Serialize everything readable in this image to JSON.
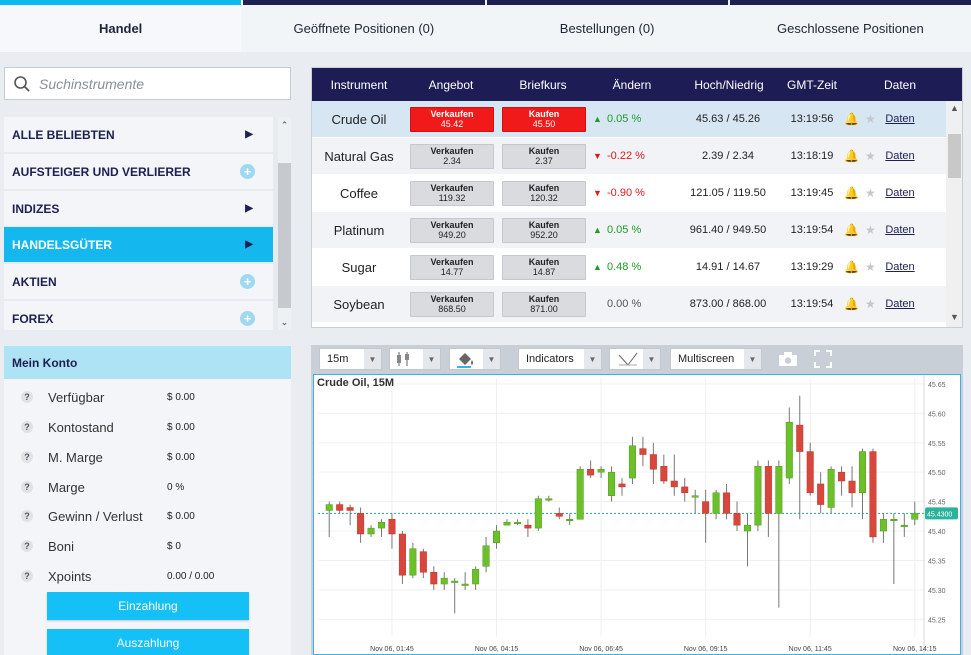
{
  "tabs": [
    {
      "label": "Handel",
      "active": true
    },
    {
      "label": "Geöffnete Positionen (0)",
      "active": false
    },
    {
      "label": "Bestellungen (0)",
      "active": false
    },
    {
      "label": "Geschlossene Positionen",
      "active": false
    }
  ],
  "search": {
    "placeholder": "Suchinstrumente"
  },
  "categories": [
    {
      "label": "ALLE BELIEBTEN",
      "marker": "arrow",
      "active": false
    },
    {
      "label": "AUFSTEIGER UND VERLIERER",
      "marker": "plus",
      "active": false
    },
    {
      "label": "INDIZES",
      "marker": "arrow",
      "active": false
    },
    {
      "label": "HANDELSGÜTER",
      "marker": "arrow",
      "active": true
    },
    {
      "label": "AKTIEN",
      "marker": "plus",
      "active": false
    },
    {
      "label": "FOREX",
      "marker": "plus",
      "active": false
    }
  ],
  "account": {
    "title": "Mein Konto",
    "rows": [
      {
        "label": "Verfügbar",
        "value": "$ 0.00"
      },
      {
        "label": "Kontostand",
        "value": "$ 0.00"
      },
      {
        "label": "M. Marge",
        "value": "$ 0.00"
      },
      {
        "label": "Marge",
        "value": "0 %"
      },
      {
        "label": "Gewinn / Verlust",
        "value": "$ 0.00"
      },
      {
        "label": "Boni",
        "value": "$ 0"
      },
      {
        "label": "Xpoints",
        "value": "0.00 / 0.00"
      }
    ],
    "deposit_label": "Einzahlung",
    "withdraw_label": "Auszahlung"
  },
  "table": {
    "headers": [
      "Instrument",
      "Angebot",
      "Briefkurs",
      "Ändern",
      "Hoch/Niedrig",
      "GMT-Zeit",
      "Daten"
    ],
    "sell_label": "Verkaufen",
    "buy_label": "Kaufen",
    "rows": [
      {
        "instrument": "Crude Oil",
        "bid": "45.42",
        "ask": "45.50",
        "change": "0.05 %",
        "dir": "up",
        "highlow": "45.63 / 45.26",
        "time": "13:19:56",
        "daten": "Daten",
        "selected": true
      },
      {
        "instrument": "Natural Gas",
        "bid": "2.34",
        "ask": "2.37",
        "change": "-0.22 %",
        "dir": "down",
        "highlow": "2.39 / 2.34",
        "time": "13:18:19",
        "daten": "Daten",
        "selected": false
      },
      {
        "instrument": "Coffee",
        "bid": "119.32",
        "ask": "120.32",
        "change": "-0.90 %",
        "dir": "down",
        "highlow": "121.05 / 119.50",
        "time": "13:19:45",
        "daten": "Daten",
        "selected": false
      },
      {
        "instrument": "Platinum",
        "bid": "949.20",
        "ask": "952.20",
        "change": "0.05 %",
        "dir": "up",
        "highlow": "961.40 / 949.50",
        "time": "13:19:54",
        "daten": "Daten",
        "selected": false
      },
      {
        "instrument": "Sugar",
        "bid": "14.77",
        "ask": "14.87",
        "change": "0.48 %",
        "dir": "up",
        "highlow": "14.91 / 14.67",
        "time": "13:19:29",
        "daten": "Daten",
        "selected": false
      },
      {
        "instrument": "Soybean",
        "bid": "868.50",
        "ask": "871.00",
        "change": "0.00 %",
        "dir": "flat",
        "highlow": "873.00 / 868.00",
        "time": "13:19:54",
        "daten": "Daten",
        "selected": false
      }
    ]
  },
  "chart_toolbar": {
    "interval": "15m",
    "indicators": "Indicators",
    "layout": "Multiscreen"
  },
  "colors": {
    "accent": "#14b8ee",
    "navy": "#1d1c55",
    "bull": "#6cc02a",
    "bear": "#d9473c"
  },
  "chart_data": {
    "type": "candlestick",
    "title": "Crude Oil, 15M",
    "ylim": [
      45.22,
      45.66
    ],
    "yticks": [
      "45.65",
      "45.60",
      "45.55",
      "45.50",
      "45.45",
      "45.40",
      "45.35",
      "45.30",
      "45.25"
    ],
    "xticks": [
      {
        "label": "Nov 06, 01:45",
        "index": 6
      },
      {
        "label": "Nov 06, 04:15",
        "index": 16
      },
      {
        "label": "Nov 06, 06:45",
        "index": 26
      },
      {
        "label": "Nov 06, 09:15",
        "index": 36
      },
      {
        "label": "Nov 06, 11:45",
        "index": 46
      },
      {
        "label": "Nov 06, 14:15",
        "index": 56
      }
    ],
    "last_price": "45.4300",
    "last_value": 45.43,
    "candles": [
      [
        45.435,
        45.445,
        45.45,
        45.39
      ],
      [
        45.445,
        45.435,
        45.45,
        45.43
      ],
      [
        45.44,
        45.435,
        45.445,
        45.41
      ],
      [
        45.43,
        45.395,
        45.44,
        45.38
      ],
      [
        45.395,
        45.405,
        45.41,
        45.39
      ],
      [
        45.405,
        45.415,
        45.42,
        45.39
      ],
      [
        45.42,
        45.395,
        45.43,
        45.37
      ],
      [
        45.395,
        45.325,
        45.4,
        45.31
      ],
      [
        45.325,
        45.37,
        45.38,
        45.32
      ],
      [
        45.365,
        45.33,
        45.37,
        45.32
      ],
      [
        45.33,
        45.31,
        45.34,
        45.3
      ],
      [
        45.31,
        45.32,
        45.33,
        45.3
      ],
      [
        45.315,
        45.315,
        45.32,
        45.26
      ],
      [
        45.31,
        45.31,
        45.33,
        45.3
      ],
      [
        45.31,
        45.335,
        45.34,
        45.3
      ],
      [
        45.34,
        45.375,
        45.39,
        45.33
      ],
      [
        45.38,
        45.4,
        45.41,
        45.37
      ],
      [
        45.41,
        45.415,
        45.42,
        45.41
      ],
      [
        45.415,
        45.415,
        45.42,
        45.41
      ],
      [
        45.41,
        45.405,
        45.42,
        45.39
      ],
      [
        45.405,
        45.455,
        45.46,
        45.4
      ],
      [
        45.455,
        45.455,
        45.46,
        45.45
      ],
      [
        45.43,
        45.425,
        45.44,
        45.42
      ],
      [
        45.42,
        45.42,
        45.43,
        45.41
      ],
      [
        45.42,
        45.505,
        45.51,
        45.42
      ],
      [
        45.505,
        45.495,
        45.52,
        45.49
      ],
      [
        45.5,
        45.505,
        45.51,
        45.49
      ],
      [
        45.46,
        45.5,
        45.51,
        45.45
      ],
      [
        45.48,
        45.475,
        45.49,
        45.46
      ],
      [
        45.49,
        45.545,
        45.56,
        45.48
      ],
      [
        45.54,
        45.53,
        45.56,
        45.51
      ],
      [
        45.53,
        45.505,
        45.55,
        45.48
      ],
      [
        45.51,
        45.485,
        45.53,
        45.48
      ],
      [
        45.485,
        45.475,
        45.53,
        45.46
      ],
      [
        45.475,
        45.465,
        45.49,
        45.45
      ],
      [
        45.46,
        45.46,
        45.47,
        45.43
      ],
      [
        45.45,
        45.43,
        45.47,
        45.38
      ],
      [
        45.43,
        45.465,
        45.47,
        45.42
      ],
      [
        45.465,
        45.43,
        45.48,
        45.42
      ],
      [
        45.43,
        45.41,
        45.45,
        45.4
      ],
      [
        45.4,
        45.41,
        45.43,
        45.34
      ],
      [
        45.41,
        45.51,
        45.52,
        45.4
      ],
      [
        45.51,
        45.43,
        45.52,
        45.39
      ],
      [
        45.43,
        45.51,
        45.52,
        45.27
      ],
      [
        45.49,
        45.585,
        45.61,
        45.48
      ],
      [
        45.58,
        45.535,
        45.63,
        45.42
      ],
      [
        45.535,
        45.465,
        45.55,
        45.46
      ],
      [
        45.48,
        45.445,
        45.5,
        45.43
      ],
      [
        45.44,
        45.505,
        45.51,
        45.43
      ],
      [
        45.5,
        45.485,
        45.51,
        45.46
      ],
      [
        45.485,
        45.465,
        45.51,
        45.44
      ],
      [
        45.465,
        45.535,
        45.54,
        45.42
      ],
      [
        45.535,
        45.39,
        45.54,
        45.38
      ],
      [
        45.4,
        45.42,
        45.43,
        45.38
      ],
      [
        45.42,
        45.42,
        45.43,
        45.31
      ],
      [
        45.41,
        45.41,
        45.43,
        45.39
      ],
      [
        45.42,
        45.43,
        45.45,
        45.41
      ]
    ]
  }
}
